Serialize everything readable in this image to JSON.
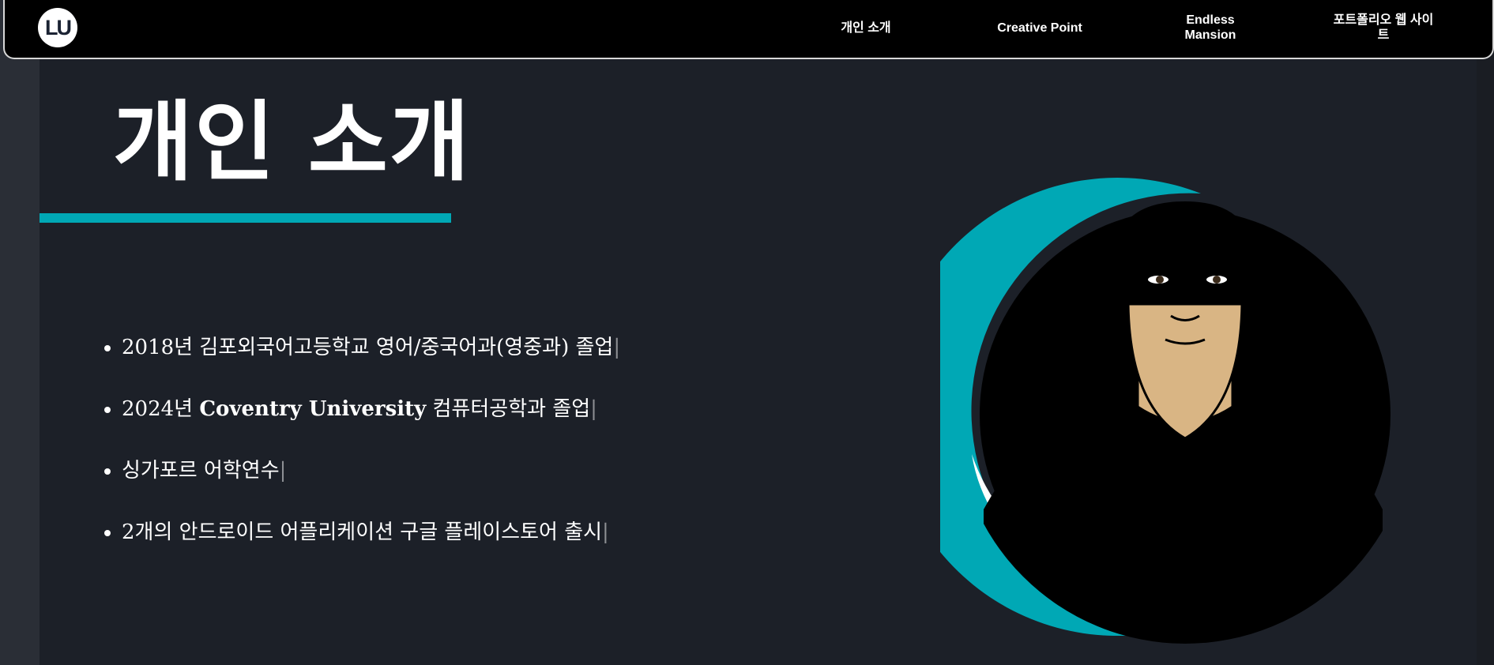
{
  "logo": {
    "text": "LU"
  },
  "nav": {
    "items": [
      {
        "label": "개인 소개"
      },
      {
        "label": "Creative Point"
      },
      {
        "label": "Endless Mansion"
      },
      {
        "label": "포트폴리오 웹 사이트"
      }
    ]
  },
  "main": {
    "title": "개인 소개",
    "bio": [
      {
        "year": "2018",
        "text": "년 김포외국어고등학교 영어/중국어과(영중과) 졸업"
      },
      {
        "year": "2024",
        "text": "년 ",
        "strong": "Coventry University",
        "text2": " 컴퓨터공학과 졸업"
      },
      {
        "text": "싱가포르 어학연수"
      },
      {
        "year": "2",
        "text": "개의 안드로이드 어플리케이션 구글 플레이스토어 출시"
      }
    ],
    "cursor": "|"
  },
  "colors": {
    "accent": "#00a8b5",
    "background": "#1c2028",
    "navbar": "#000000",
    "text": "#ffffff"
  },
  "icons": {
    "avatar": "cartoon-portrait-avatar"
  }
}
